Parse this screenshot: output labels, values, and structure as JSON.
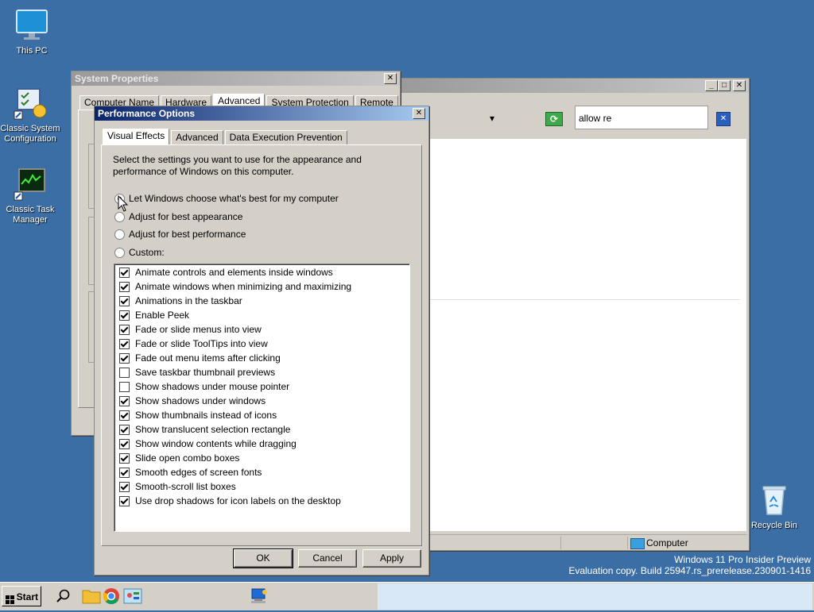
{
  "desktop": {
    "icons": [
      {
        "label": "This PC"
      },
      {
        "label": "Classic System Configuration"
      },
      {
        "label": "Classic Task Manager"
      },
      {
        "label": "Recycle Bin"
      }
    ]
  },
  "system_properties": {
    "title": "System Properties",
    "tabs": [
      "Computer Name",
      "Hardware",
      "Advanced",
      "System Protection",
      "Remote"
    ]
  },
  "explorer": {
    "search_value": "allow re",
    "status_location": "Computer",
    "dropdown_glyph": "▾",
    "refresh_glyph": "⟳",
    "clear_glyph": "✕"
  },
  "perf": {
    "title": "Performance Options",
    "tabs": [
      "Visual Effects",
      "Advanced",
      "Data Execution Prevention"
    ],
    "description": "Select the settings you want to use for the appearance and performance of Windows on this computer.",
    "radios": [
      {
        "label": "Let Windows choose what's best for my computer",
        "selected": true
      },
      {
        "label": "Adjust for best appearance",
        "selected": false
      },
      {
        "label": "Adjust for best performance",
        "selected": false
      },
      {
        "label": "Custom:",
        "selected": false
      }
    ],
    "effects": [
      {
        "label": "Animate controls and elements inside windows",
        "checked": true
      },
      {
        "label": "Animate windows when minimizing and maximizing",
        "checked": true
      },
      {
        "label": "Animations in the taskbar",
        "checked": true
      },
      {
        "label": "Enable Peek",
        "checked": true
      },
      {
        "label": "Fade or slide menus into view",
        "checked": true
      },
      {
        "label": "Fade or slide ToolTips into view",
        "checked": true
      },
      {
        "label": "Fade out menu items after clicking",
        "checked": true
      },
      {
        "label": "Save taskbar thumbnail previews",
        "checked": false
      },
      {
        "label": "Show shadows under mouse pointer",
        "checked": false
      },
      {
        "label": "Show shadows under windows",
        "checked": true
      },
      {
        "label": "Show thumbnails instead of icons",
        "checked": true
      },
      {
        "label": "Show translucent selection rectangle",
        "checked": true
      },
      {
        "label": "Show window contents while dragging",
        "checked": true
      },
      {
        "label": "Slide open combo boxes",
        "checked": true
      },
      {
        "label": "Smooth edges of screen fonts",
        "checked": true
      },
      {
        "label": "Smooth-scroll list boxes",
        "checked": true
      },
      {
        "label": "Use drop shadows for icon labels on the desktop",
        "checked": true
      }
    ],
    "buttons": {
      "ok": "OK",
      "cancel": "Cancel",
      "apply": "Apply"
    }
  },
  "watermark": {
    "line1": "Windows 11 Pro Insider Preview",
    "line2": "Evaluation copy. Build 25947.rs_prerelease.230901-1416"
  },
  "taskbar": {
    "start_label": "Start"
  },
  "window_buttons": {
    "close": "✕",
    "minimize": "_",
    "maximize": "□"
  }
}
